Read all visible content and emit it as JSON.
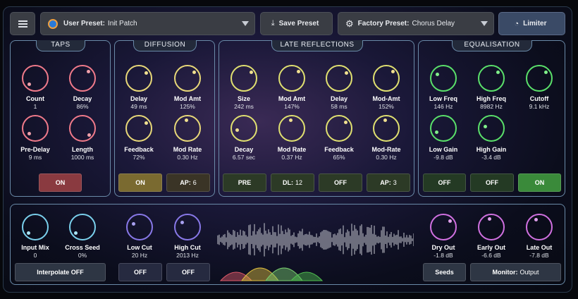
{
  "topbar": {
    "menu_icon": "hamburger-menu-icon",
    "user_preset": {
      "label": "User Preset:",
      "value": "Init Patch"
    },
    "save_preset": "Save Preset",
    "factory_preset": {
      "label": "Factory Preset:",
      "value": "Chorus Delay"
    },
    "limiter": "Limiter"
  },
  "taps": {
    "title": "TAPS",
    "knobs": [
      {
        "label": "Count",
        "value": "1"
      },
      {
        "label": "Decay",
        "value": "86%"
      },
      {
        "label": "Pre-Delay",
        "value": "9 ms"
      },
      {
        "label": "Length",
        "value": "1000 ms"
      }
    ],
    "button": "ON"
  },
  "diffusion": {
    "title": "DIFFUSION",
    "knobs": [
      {
        "label": "Delay",
        "value": "49 ms"
      },
      {
        "label": "Mod Amt",
        "value": "125%"
      },
      {
        "label": "Feedback",
        "value": "72%"
      },
      {
        "label": "Mod Rate",
        "value": "0.30 Hz"
      }
    ],
    "btn_on": "ON",
    "btn_ap": {
      "label": "AP:",
      "value": "6"
    }
  },
  "late": {
    "title": "LATE REFLECTIONS",
    "knobs": [
      {
        "label": "Size",
        "value": "242 ms"
      },
      {
        "label": "Mod Amt",
        "value": "147%"
      },
      {
        "label": "Delay",
        "value": "58 ms"
      },
      {
        "label": "Mod-Amt",
        "value": "152%"
      },
      {
        "label": "Decay",
        "value": "6.57 sec"
      },
      {
        "label": "Mod Rate",
        "value": "0.37 Hz"
      },
      {
        "label": "Feedback",
        "value": "65%"
      },
      {
        "label": "Mod-Rate",
        "value": "0.30 Hz"
      }
    ],
    "btn_pre": "PRE",
    "btn_dl": {
      "label": "DL:",
      "value": "12"
    },
    "btn_off": "OFF",
    "btn_ap": {
      "label": "AP:",
      "value": "3"
    }
  },
  "eq": {
    "title": "EQUALISATION",
    "knobs": [
      {
        "label": "Low Freq",
        "value": "146 Hz"
      },
      {
        "label": "High Freq",
        "value": "8982 Hz"
      },
      {
        "label": "Cutoff",
        "value": "9.1 kHz"
      },
      {
        "label": "Low Gain",
        "value": "-9.8 dB"
      },
      {
        "label": "High Gain",
        "value": "-3.4 dB"
      }
    ],
    "btn1": "OFF",
    "btn2": "OFF",
    "btn3": "ON"
  },
  "bottom": {
    "knobs": [
      {
        "label": "Input Mix",
        "value": "0"
      },
      {
        "label": "Cross Seed",
        "value": "0%"
      },
      {
        "label": "Low Cut",
        "value": "20 Hz"
      },
      {
        "label": "High Cut",
        "value": "2013 Hz"
      },
      {
        "label": "Dry Out",
        "value": "-1.8 dB"
      },
      {
        "label": "Early Out",
        "value": "-6.6 dB"
      },
      {
        "label": "Late Out",
        "value": "-7.8 dB"
      }
    ],
    "interpolate": "Interpolate OFF",
    "lowcut_btn": "OFF",
    "highcut_btn": "OFF",
    "seeds": "Seeds",
    "monitor": {
      "label": "Monitor:",
      "value": "Output"
    }
  },
  "colors": {
    "taps": "#f07a8a",
    "diffusion": "#e8d878",
    "late": "#d8e878",
    "eq": "#5ae06a",
    "io": "#7ad0ec",
    "cut": "#8878e8",
    "out": "#d070e0"
  }
}
